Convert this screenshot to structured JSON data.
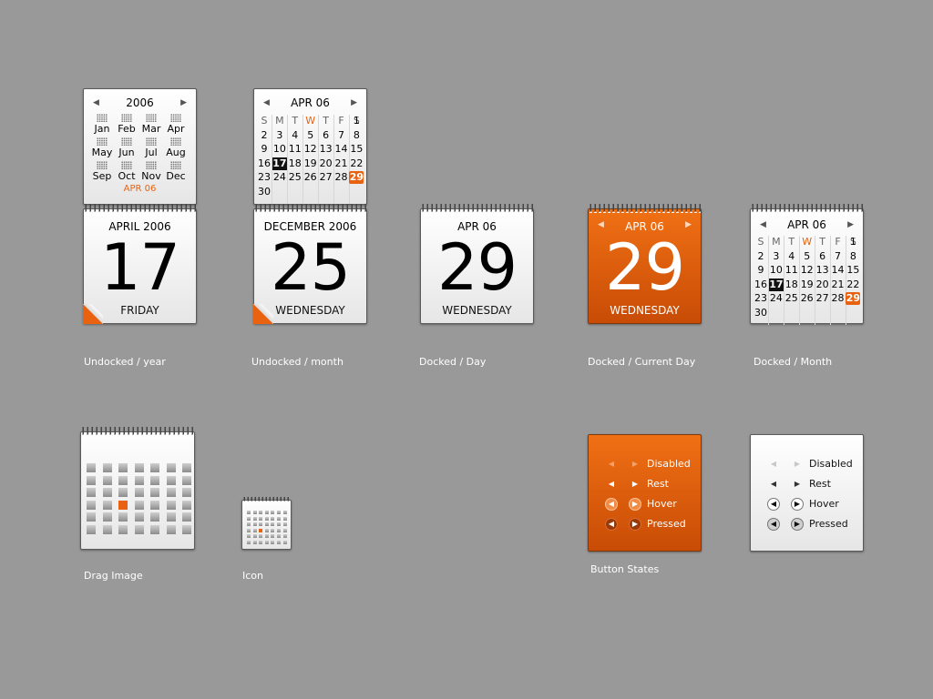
{
  "year_card": {
    "year": "2006",
    "months": [
      "Jan",
      "Feb",
      "Mar",
      "Apr",
      "May",
      "Jun",
      "Jul",
      "Aug",
      "Sep",
      "Oct",
      "Nov",
      "Dec"
    ],
    "current": "APR 06"
  },
  "month_card": {
    "title": "APR 06",
    "weekdays": [
      "S",
      "M",
      "T",
      "W",
      "T",
      "F",
      "S"
    ],
    "days": [
      "1",
      "2",
      "3",
      "4",
      "5",
      "6",
      "7",
      "8",
      "9",
      "10",
      "11",
      "12",
      "13",
      "14",
      "15",
      "16",
      "17",
      "18",
      "19",
      "20",
      "21",
      "22",
      "23",
      "24",
      "25",
      "26",
      "27",
      "28",
      "29",
      "30"
    ],
    "selected": "17",
    "today": "29"
  },
  "undocked_year": {
    "header": "APRIL 2006",
    "day": "17",
    "weekday": "FRIDAY",
    "caption": "Undocked / year"
  },
  "undocked_month": {
    "header": "DECEMBER 2006",
    "day": "25",
    "weekday": "WEDNESDAY",
    "caption": "Undocked / month"
  },
  "docked_day": {
    "header": "APR 06",
    "day": "29",
    "weekday": "WEDNESDAY",
    "caption": "Docked / Day"
  },
  "docked_current": {
    "header": "APR 06",
    "day": "29",
    "weekday": "WEDNESDAY",
    "caption": "Docked / Current Day"
  },
  "docked_month": {
    "caption": "Docked / Month"
  },
  "drag_image": {
    "caption": "Drag Image"
  },
  "icon": {
    "caption": "Icon"
  },
  "button_states": {
    "caption": "Button States",
    "states": [
      "Disabled",
      "Rest",
      "Hover",
      "Pressed"
    ]
  },
  "colors": {
    "background": "#999999",
    "accent": "#e8620f",
    "selected": "#111111"
  }
}
